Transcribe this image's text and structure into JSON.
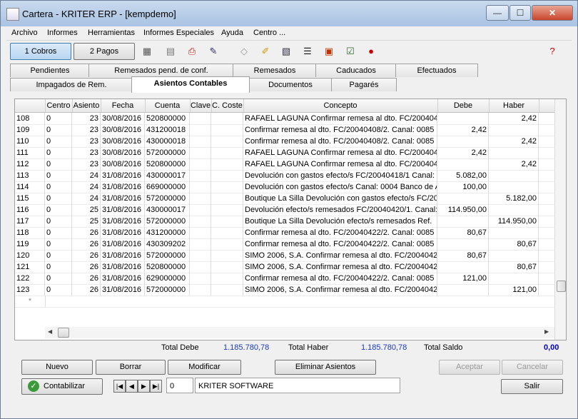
{
  "window": {
    "title": "Cartera - KRITER ERP - [kempdemo]",
    "minimize": "—",
    "maximize": "☐",
    "close": "✕"
  },
  "menu": [
    "Archivo",
    "Informes",
    "Herramientas",
    "Informes Especiales",
    "Ayuda",
    "Centro ..."
  ],
  "toolbar": {
    "cobros_label": "1 Cobros",
    "pagos_label": "2 Pagos"
  },
  "tabs_top": [
    "Pendientes",
    "Remesados pend. de conf.",
    "Remesados",
    "Caducados",
    "Efectuados"
  ],
  "tabs_bottom": [
    "Impagados de Rem.",
    "Asientos Contables",
    "Documentos",
    "Pagarés"
  ],
  "active_tab": "Asientos Contables",
  "grid": {
    "columns": [
      "Centro",
      "Asiento",
      "Fecha",
      "Cuenta",
      "Clave",
      "C. Coste",
      "Concepto",
      "Debe",
      "Haber"
    ],
    "rows": [
      [
        "108",
        "0",
        "23",
        "30/08/2016",
        "520800000",
        "",
        "",
        "RAFAEL LAGUNA Confirmar remesa al dto. FC/20040408",
        "",
        "2,42"
      ],
      [
        "109",
        "0",
        "23",
        "30/08/2016",
        "431200018",
        "",
        "",
        "Confirmar remesa al dto. FC/20040408/2. Canal: 0085 Ba",
        "2,42",
        ""
      ],
      [
        "110",
        "0",
        "23",
        "30/08/2016",
        "430000018",
        "",
        "",
        "Confirmar remesa al dto. FC/20040408/2. Canal: 0085 Ba",
        "",
        "2,42"
      ],
      [
        "111",
        "0",
        "23",
        "30/08/2016",
        "572000000",
        "",
        "",
        "RAFAEL LAGUNA Confirmar remesa al dto. FC/20040408",
        "2,42",
        ""
      ],
      [
        "112",
        "0",
        "23",
        "30/08/2016",
        "520800000",
        "",
        "",
        "RAFAEL LAGUNA Confirmar remesa al dto. FC/20040408",
        "",
        "2,42"
      ],
      [
        "113",
        "0",
        "24",
        "31/08/2016",
        "430000017",
        "",
        "",
        "Devolución con gastos efecto/s FC/20040418/1 Canal: 0",
        "5.082,00",
        ""
      ],
      [
        "114",
        "0",
        "24",
        "31/08/2016",
        "669000000",
        "",
        "",
        "Devolución con gastos efecto/s Canal: 0004 Banco de A",
        "100,00",
        ""
      ],
      [
        "115",
        "0",
        "24",
        "31/08/2016",
        "572000000",
        "",
        "",
        "Boutique La Silla Devolución con gastos efecto/s FC/200",
        "",
        "5.182,00"
      ],
      [
        "116",
        "0",
        "25",
        "31/08/2016",
        "430000017",
        "",
        "",
        "Devolución efecto/s remesados FC/20040420/1. Canal:",
        "114.950,00",
        ""
      ],
      [
        "117",
        "0",
        "25",
        "31/08/2016",
        "572000000",
        "",
        "",
        "Boutique La Silla Devolución efecto/s remesados Ref.",
        "",
        "114.950,00"
      ],
      [
        "118",
        "0",
        "26",
        "31/08/2016",
        "431200000",
        "",
        "",
        "Confirmar remesa al dto. FC/20040422/2. Canal: 0085 Ba",
        "80,67",
        ""
      ],
      [
        "119",
        "0",
        "26",
        "31/08/2016",
        "430309202",
        "",
        "",
        "Confirmar remesa al dto. FC/20040422/2. Canal: 0085 Ba",
        "",
        "80,67"
      ],
      [
        "120",
        "0",
        "26",
        "31/08/2016",
        "572000000",
        "",
        "",
        "SIMO 2006, S.A. Confirmar remesa al dto. FC/20040422/",
        "80,67",
        ""
      ],
      [
        "121",
        "0",
        "26",
        "31/08/2016",
        "520800000",
        "",
        "",
        "SIMO 2006, S.A. Confirmar remesa al dto. FC/20040422/",
        "",
        "80,67"
      ],
      [
        "122",
        "0",
        "26",
        "31/08/2016",
        "629000000",
        "",
        "",
        "Confirmar remesa al dto. FC/20040422/2. Canal: 0085 Ba",
        "121,00",
        ""
      ],
      [
        "123",
        "0",
        "26",
        "31/08/2016",
        "572000000",
        "",
        "",
        "SIMO 2006, S.A. Confirmar remesa al dto. FC/20040422/",
        "",
        "121,00"
      ]
    ],
    "new_row_marker": "*"
  },
  "totals": {
    "debe_label": "Total Debe",
    "debe_value": "1.185.780,78",
    "haber_label": "Total Haber",
    "haber_value": "1.185.780,78",
    "saldo_label": "Total Saldo",
    "saldo_value": "0,00"
  },
  "buttons": {
    "nuevo": "Nuevo",
    "borrar": "Borrar",
    "modificar": "Modificar",
    "eliminar": "Eliminar Asientos",
    "aceptar": "Aceptar",
    "cancelar": "Cancelar",
    "contabilizar": "Contabilizar",
    "salir": "Salir"
  },
  "status": {
    "record_field": "0",
    "company": "KRITER SOFTWARE"
  },
  "colors": {
    "accent": "#1a3bbf",
    "saldo": "#0000cc"
  }
}
